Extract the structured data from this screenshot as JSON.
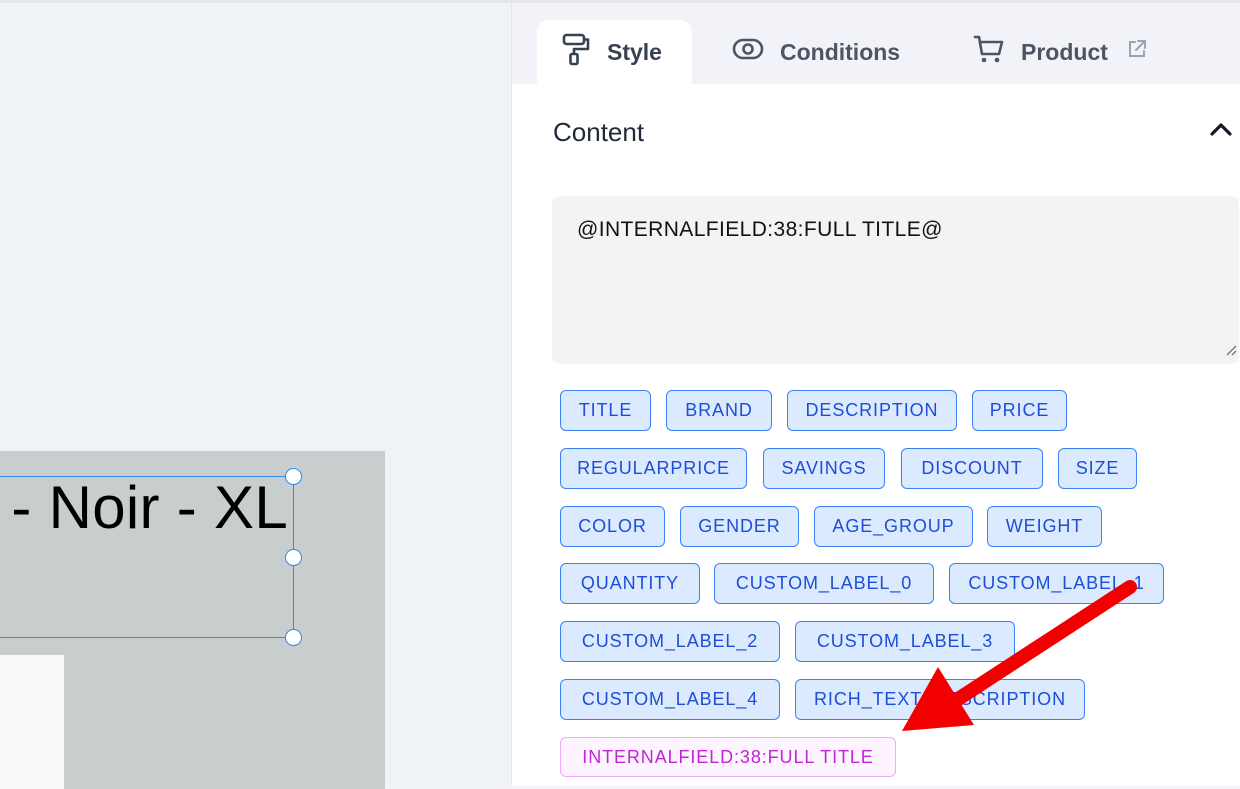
{
  "canvas": {
    "selected_text": "- Noir - XL"
  },
  "tabs": [
    {
      "label": "Style",
      "icon": "paint-roller-icon",
      "active": true
    },
    {
      "label": "Conditions",
      "icon": "eye-icon",
      "active": false
    },
    {
      "label": "Product",
      "icon": "cart-icon",
      "extra_icon": "external-link-icon",
      "active": false
    }
  ],
  "content": {
    "title": "Content",
    "value": "@INTERNALFIELD:38:FULL TITLE@"
  },
  "fields": [
    "TITLE",
    "BRAND",
    "DESCRIPTION",
    "PRICE",
    "REGULARPRICE",
    "SAVINGS",
    "DISCOUNT",
    "SIZE",
    "COLOR",
    "GENDER",
    "AGE_GROUP",
    "WEIGHT",
    "QUANTITY",
    "CUSTOM_LABEL_0",
    "CUSTOM_LABEL_1",
    "CUSTOM_LABEL_2",
    "CUSTOM_LABEL_3",
    "CUSTOM_LABEL_4",
    "RICH_TEXT_DESCRIPTION"
  ],
  "internal_field": "INTERNALFIELD:38:FULL TITLE",
  "colors": {
    "tag_border": "#3b82f6",
    "tag_bg": "#dbeafe",
    "tag_text": "#1d4ed8",
    "internal_text": "#c026d3",
    "annotation_arrow": "#f20000",
    "selection": "#2d8cf0"
  }
}
